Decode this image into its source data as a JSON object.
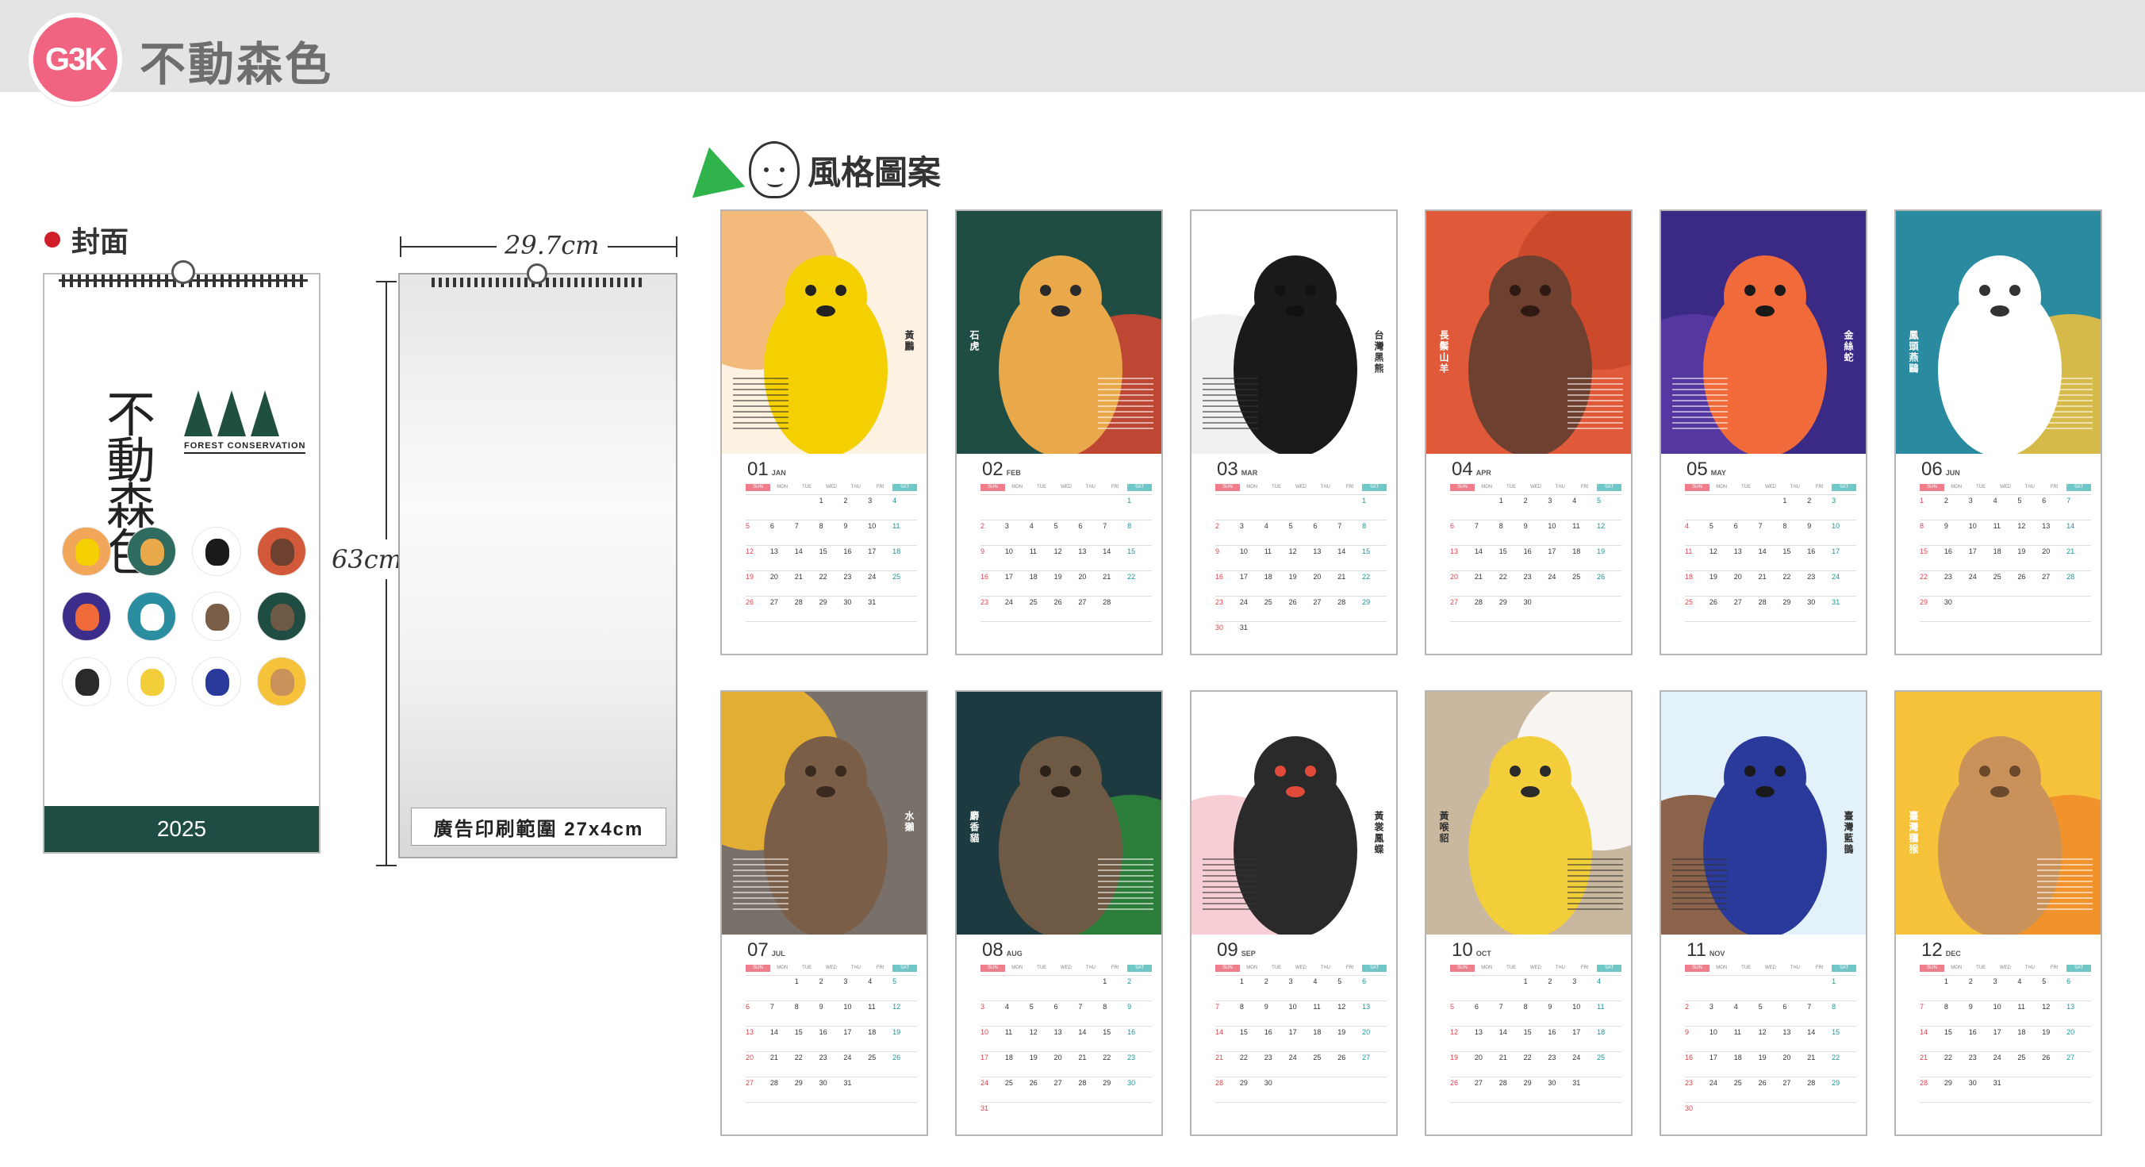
{
  "header": {
    "badge": "G3K",
    "title": "不動森色"
  },
  "cover": {
    "section_label": "封面",
    "logo_text": "不動森色",
    "logo_sub": "FOREST CONSERVATION",
    "year": "2025",
    "circles": [
      "#f2a65a",
      "#2f6b5e",
      "#ffffff",
      "#d25a3a",
      "#3b2e8a",
      "#2a8ea0",
      "#ffffff",
      "#1f4d43",
      "#ffffff",
      "#ffffff",
      "#ffffff",
      "#f5c23a"
    ]
  },
  "dimensions": {
    "width": "29.7cm",
    "height": "63cm",
    "ad_area": "廣告印刷範圍 27x4cm"
  },
  "style_section": {
    "title": "風格圖案"
  },
  "weekdays": [
    "SUN",
    "MON",
    "TUE",
    "WED",
    "THU",
    "FRI",
    "SAT"
  ],
  "months": [
    {
      "num": "01",
      "abbr": "JAN",
      "animal": "黃鸝",
      "bg": "#fdf1e2",
      "accent": "#f0b26a",
      "body": "#f5d000",
      "dark": "#222222",
      "start": 3,
      "days": 31
    },
    {
      "num": "02",
      "abbr": "FEB",
      "animal": "石虎",
      "bg": "#1f4d43",
      "accent": "#d9472f",
      "body": "#e9a84a",
      "dark": "#2b2b2b",
      "start": 6,
      "days": 28
    },
    {
      "num": "03",
      "abbr": "MAR",
      "animal": "台灣黑熊",
      "bg": "#ffffff",
      "accent": "#eeeeee",
      "body": "#1a1a1a",
      "dark": "#111111",
      "start": 6,
      "days": 31
    },
    {
      "num": "04",
      "abbr": "APR",
      "animal": "長鬃山羊",
      "bg": "#e05a3a",
      "accent": "#c9462a",
      "body": "#6d4030",
      "dark": "#2e1a12",
      "start": 2,
      "days": 30
    },
    {
      "num": "05",
      "abbr": "MAY",
      "animal": "金絲蛇",
      "bg": "#3a2a86",
      "accent": "#5a3aa6",
      "body": "#f06a3a",
      "dark": "#1a1a1a",
      "start": 4,
      "days": 31
    },
    {
      "num": "06",
      "abbr": "JUN",
      "animal": "鳳頭燕鷗",
      "bg": "#2a8aa0",
      "accent": "#f5c23a",
      "body": "#ffffff",
      "dark": "#333333",
      "start": 0,
      "days": 30
    },
    {
      "num": "07",
      "abbr": "JUL",
      "animal": "水獺",
      "bg": "#7a706a",
      "accent": "#f5b82a",
      "body": "#7a5e48",
      "dark": "#3a2a20",
      "start": 2,
      "days": 31
    },
    {
      "num": "08",
      "abbr": "AUG",
      "animal": "麝香貓",
      "bg": "#1c3a40",
      "accent": "#2f8a3a",
      "body": "#6e5a44",
      "dark": "#2a2018",
      "start": 5,
      "days": 31
    },
    {
      "num": "09",
      "abbr": "SEP",
      "animal": "黃裳鳳蝶",
      "bg": "#ffffff",
      "accent": "#f5c6cc",
      "body": "#2a2a2a",
      "dark": "#e04a3a",
      "start": 1,
      "days": 30
    },
    {
      "num": "10",
      "abbr": "OCT",
      "animal": "黃喉貂",
      "bg": "#c9b7a0",
      "accent": "#ffffff",
      "body": "#f2cf3a",
      "dark": "#2a2a2a",
      "start": 3,
      "days": 31
    },
    {
      "num": "11",
      "abbr": "NOV",
      "animal": "臺灣藍鵲",
      "bg": "#e3f1fa",
      "accent": "#7a4a2a",
      "body": "#2a3a9a",
      "dark": "#1a1a1a",
      "start": 6,
      "days": 30
    },
    {
      "num": "12",
      "abbr": "DEC",
      "animal": "臺灣獼猴",
      "bg": "#f5c23a",
      "accent": "#f08a2a",
      "body": "#c9925a",
      "dark": "#6a4a2a",
      "start": 1,
      "days": 31
    }
  ]
}
